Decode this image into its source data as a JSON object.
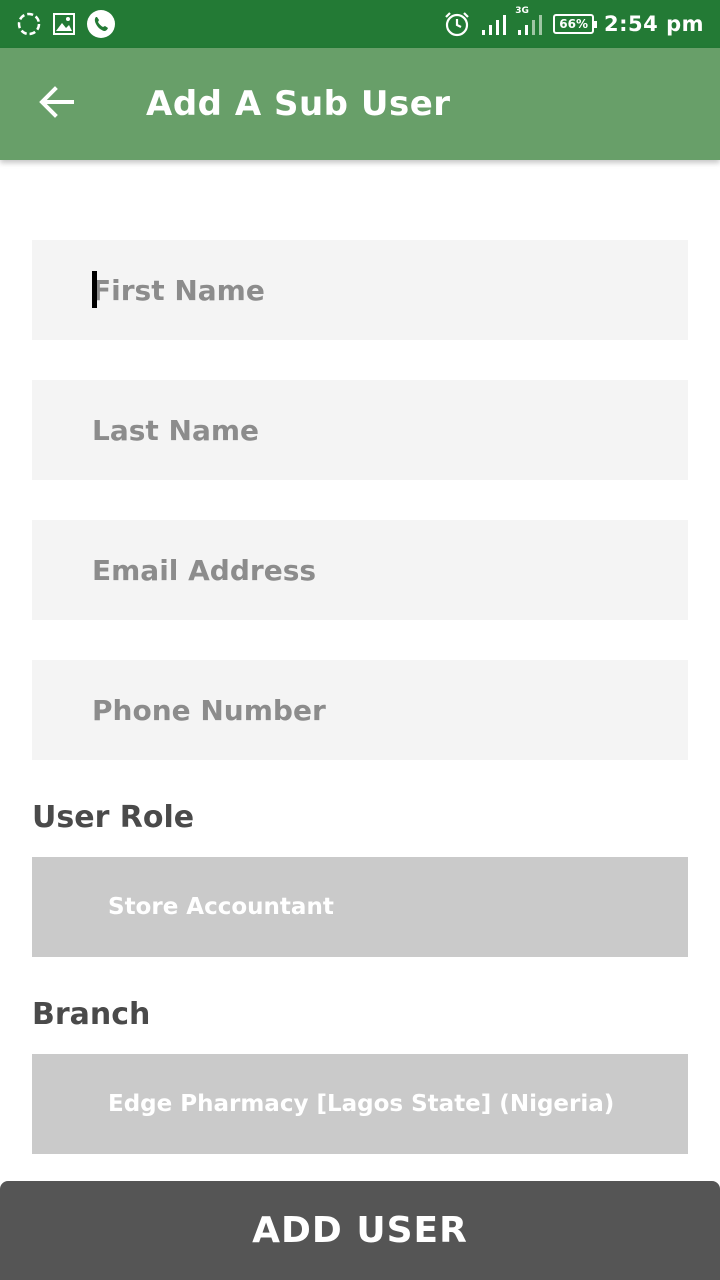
{
  "status_bar": {
    "time": "2:54 pm",
    "battery": "66%",
    "network": "3G",
    "icons": [
      "sync-icon",
      "gallery-icon",
      "whatsapp-icon",
      "alarm-icon",
      "signal-icon",
      "signal-icon-3g",
      "battery-icon"
    ]
  },
  "app_bar": {
    "title": "Add A Sub User",
    "back_icon": "arrow-left-icon"
  },
  "form": {
    "first_name": {
      "placeholder": "First Name",
      "value": ""
    },
    "last_name": {
      "placeholder": "Last Name",
      "value": ""
    },
    "email": {
      "placeholder": "Email Address",
      "value": ""
    },
    "phone": {
      "placeholder": "Phone Number",
      "value": ""
    },
    "user_role": {
      "label": "User Role",
      "selected": "Store Accountant"
    },
    "branch": {
      "label": "Branch",
      "selected": "Edge Pharmacy [Lagos State]  (Nigeria)"
    }
  },
  "submit": {
    "label": "ADD USER"
  },
  "colors": {
    "status_bar": "#237a35",
    "app_bar": "#689f69",
    "input_bg": "#f4f4f4",
    "select_bg": "#cacaca",
    "button_bg": "#555555"
  }
}
